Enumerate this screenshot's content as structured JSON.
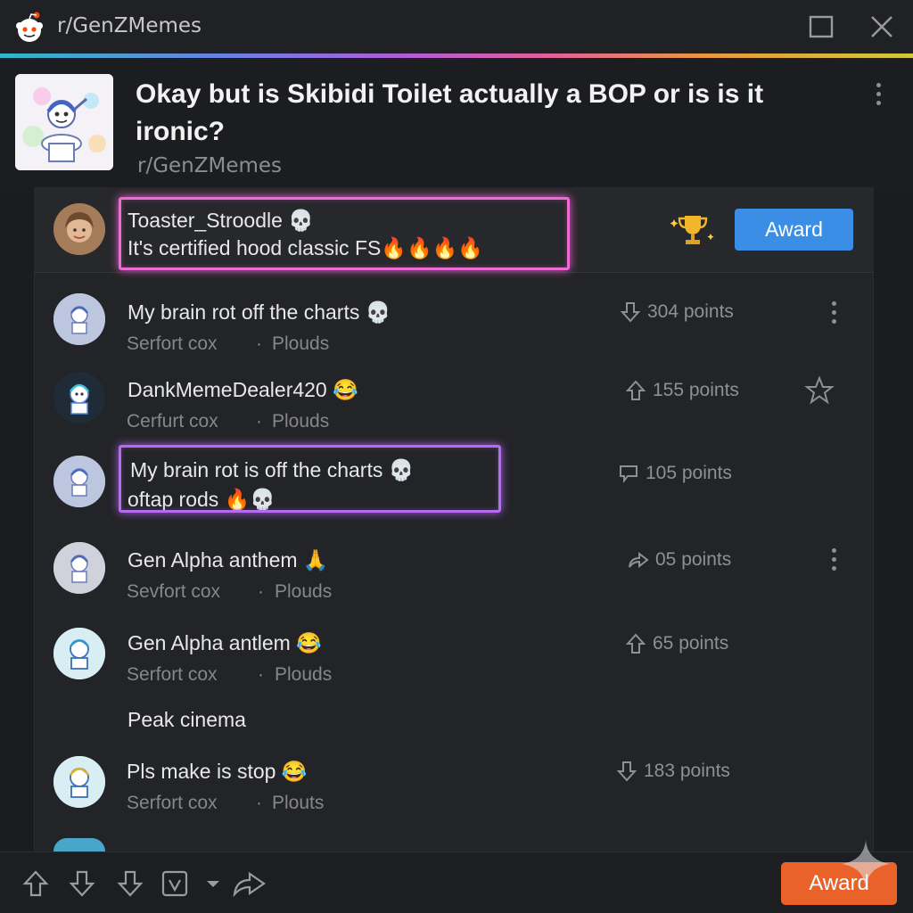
{
  "window": {
    "title": "r/GenZMemes"
  },
  "post": {
    "title": "Okay but is Skibidi Toilet actually a BOP or is is it ironic?",
    "subreddit": "r/GenZMemes"
  },
  "featured_comment": {
    "username": "Toaster_Stroodle 💀",
    "text": "It's certified hood classic FS🔥🔥🔥🔥",
    "award_label": "Award"
  },
  "comments": [
    {
      "title": "My brain rot  off the charts 💀",
      "author": "Serfort cox",
      "sub": "Plouds",
      "points": "304 points"
    },
    {
      "title": "DankMemeDealer420 😂",
      "author": "Cerfurt cox",
      "sub": "Plouds",
      "points": "155 points"
    },
    {
      "title": "My brain rot is off   the charts 💀",
      "line2": "oftap rods 🔥💀",
      "points": "105 points"
    },
    {
      "title": "Gen Alpha anthem 🙏",
      "author": "Sevfort cox",
      "sub": "Plouds",
      "points": "05 points"
    },
    {
      "title": "Gen Alpha antlem 😂",
      "author": "Serfort cox",
      "sub": "Plouds",
      "points": "65 points"
    },
    {
      "title": "Peak cinema"
    },
    {
      "title": "Pls make is stop 😂",
      "author": "Serfort cox",
      "sub": "Plouts",
      "points": "183 points"
    }
  ],
  "bottom_bar": {
    "award_label": "Award"
  },
  "colors": {
    "award_blue": "#3b8ee6",
    "award_orange": "#e8622a",
    "glow_pink": "#f06ad6",
    "glow_purple": "#b66cf0"
  }
}
